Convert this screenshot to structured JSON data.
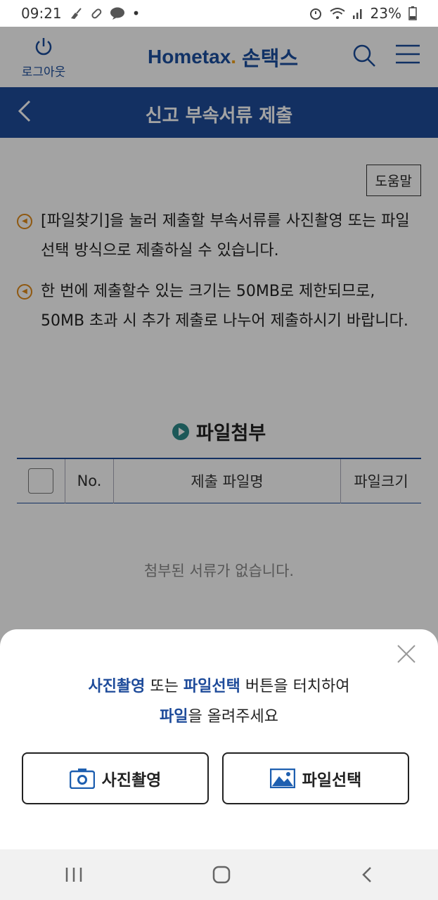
{
  "status_bar": {
    "time": "09:21",
    "battery": "23%"
  },
  "header": {
    "logout_label": "로그아웃",
    "logo_en_prefix": "Home",
    "logo_en_mid": "tax",
    "logo_en_dot": ".",
    "logo_ko": "손택스"
  },
  "titlebar": {
    "title": "신고 부속서류 제출"
  },
  "content": {
    "help_button": "도움말",
    "notice_1": "[파일찾기]을 눌러 제출할 부속서류를 사진촬영 또는 파일선택 방식으로 제출하실 수 있습니다.",
    "notice_2": "한 번에 제출할수 있는 크기는 50MB로 제한되므로, 50MB 초과 시 추가 제출로 나누어 제출하시기 바랍니다.",
    "attach_title": "파일첨부",
    "table_headers": {
      "no": "No.",
      "filename": "제출 파일명",
      "size": "파일크기"
    },
    "empty_message": "첨부된 서류가 없습니다."
  },
  "sheet": {
    "msg_hl1": "사진촬영",
    "msg_t1": " 또는 ",
    "msg_hl2": "파일선택",
    "msg_t2": " 버튼을 터치하여",
    "msg_hl3": "파일",
    "msg_t3": "을 올려주세요",
    "camera_button": "사진촬영",
    "file_button": "파일선택"
  },
  "colors": {
    "brand_blue": "#1e4b9a",
    "accent_orange": "#f2a31b"
  }
}
